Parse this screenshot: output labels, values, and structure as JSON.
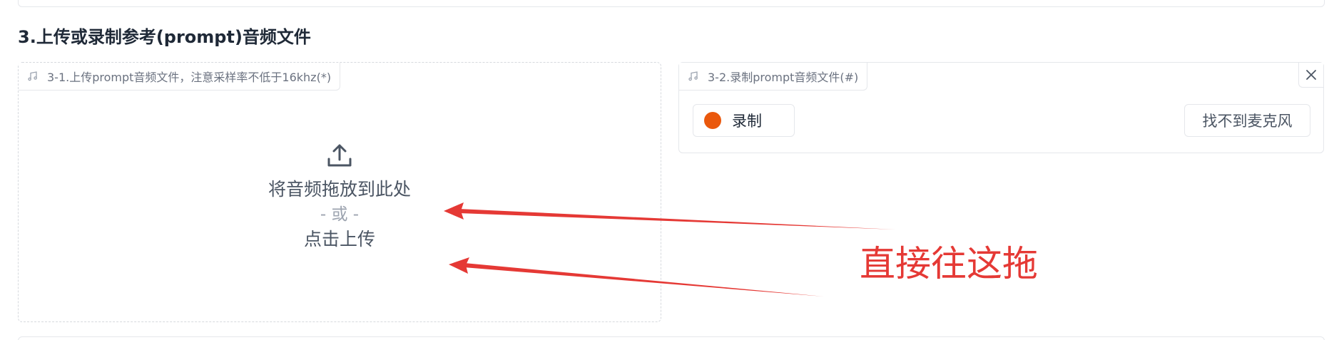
{
  "section": {
    "title": "3.上传或录制参考(prompt)音频文件"
  },
  "upload": {
    "label": "3-1.上传prompt音频文件，注意采样率不低于16khz(*)",
    "drop_text": "将音频拖放到此处",
    "or_text": "- 或 -",
    "click_text": "点击上传"
  },
  "record": {
    "label": "3-2.录制prompt音频文件(#)",
    "record_button": "录制",
    "mic_button": "找不到麦克风"
  },
  "annotation": {
    "text": "直接往这拖"
  },
  "colors": {
    "record_dot": "#ea580c",
    "annotation": "#e53935"
  }
}
